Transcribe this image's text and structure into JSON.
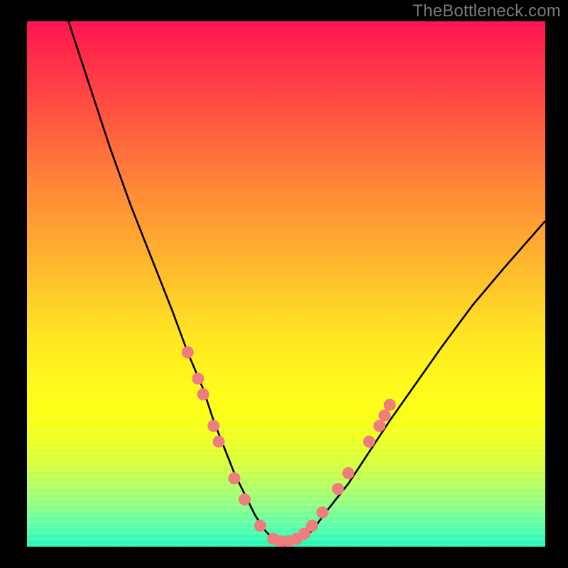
{
  "watermark": "TheBottleneck.com",
  "chart_data": {
    "type": "line",
    "title": "",
    "xlabel": "",
    "ylabel": "",
    "xlim": [
      0,
      100
    ],
    "ylim": [
      0,
      100
    ],
    "grid": false,
    "series": [
      {
        "name": "bottleneck-curve",
        "x": [
          8,
          12,
          16,
          20,
          24,
          28,
          31,
          34,
          36,
          38,
          40,
          42,
          44,
          46,
          48,
          50,
          52,
          55,
          58,
          62,
          66,
          70,
          75,
          80,
          86,
          92,
          100
        ],
        "y": [
          100,
          88,
          76,
          65,
          55,
          45,
          37,
          30,
          24,
          19,
          14,
          10,
          6,
          3,
          1,
          0,
          1,
          3,
          7,
          12,
          18,
          24,
          31,
          38,
          46,
          53,
          62
        ]
      }
    ],
    "markers": {
      "name": "highlight-dots",
      "color": "#ef7d7d",
      "points": [
        {
          "x": 31,
          "y": 37
        },
        {
          "x": 33,
          "y": 32
        },
        {
          "x": 34,
          "y": 29
        },
        {
          "x": 36,
          "y": 23
        },
        {
          "x": 37,
          "y": 20
        },
        {
          "x": 40,
          "y": 13
        },
        {
          "x": 42,
          "y": 9
        },
        {
          "x": 45,
          "y": 4
        },
        {
          "x": 47.5,
          "y": 1.5
        },
        {
          "x": 49,
          "y": 1
        },
        {
          "x": 50.5,
          "y": 1
        },
        {
          "x": 52,
          "y": 1.5
        },
        {
          "x": 53.5,
          "y": 2.5
        },
        {
          "x": 55,
          "y": 4
        },
        {
          "x": 57,
          "y": 6.5
        },
        {
          "x": 60,
          "y": 11
        },
        {
          "x": 62,
          "y": 14
        },
        {
          "x": 66,
          "y": 20
        },
        {
          "x": 68,
          "y": 23
        },
        {
          "x": 69,
          "y": 25
        },
        {
          "x": 70,
          "y": 27
        }
      ]
    },
    "gradient_stops": [
      {
        "pos": 0,
        "color": "#ff1450"
      },
      {
        "pos": 50,
        "color": "#ffe622"
      },
      {
        "pos": 78,
        "color": "#fdff1a"
      },
      {
        "pos": 100,
        "color": "#22f7b8"
      }
    ]
  }
}
